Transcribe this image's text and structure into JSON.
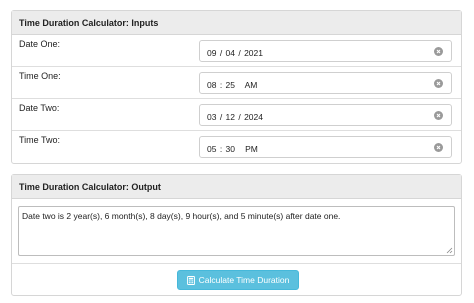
{
  "inputs_panel": {
    "title": "Time Duration Calculator: Inputs",
    "rows": [
      {
        "label": "Date One:",
        "value": "09 / 04 / 2021"
      },
      {
        "label": "Time One:",
        "value": "08 : 25   AM"
      },
      {
        "label": "Date Two:",
        "value": "03 / 12 / 2024"
      },
      {
        "label": "Time Two:",
        "value": "05 : 30   PM"
      }
    ]
  },
  "output_panel": {
    "title": "Time Duration Calculator: Output",
    "result": "Date two is 2 year(s), 6 month(s), 8 day(s), 9 hour(s), and 5 minute(s) after date one.",
    "button_label": "Calculate Time Duration"
  },
  "icons": {
    "clear": "clear-circle-icon",
    "calculator": "calculator-icon"
  },
  "colors": {
    "button_bg": "#5bc0de",
    "heading_bg": "#ececec"
  }
}
